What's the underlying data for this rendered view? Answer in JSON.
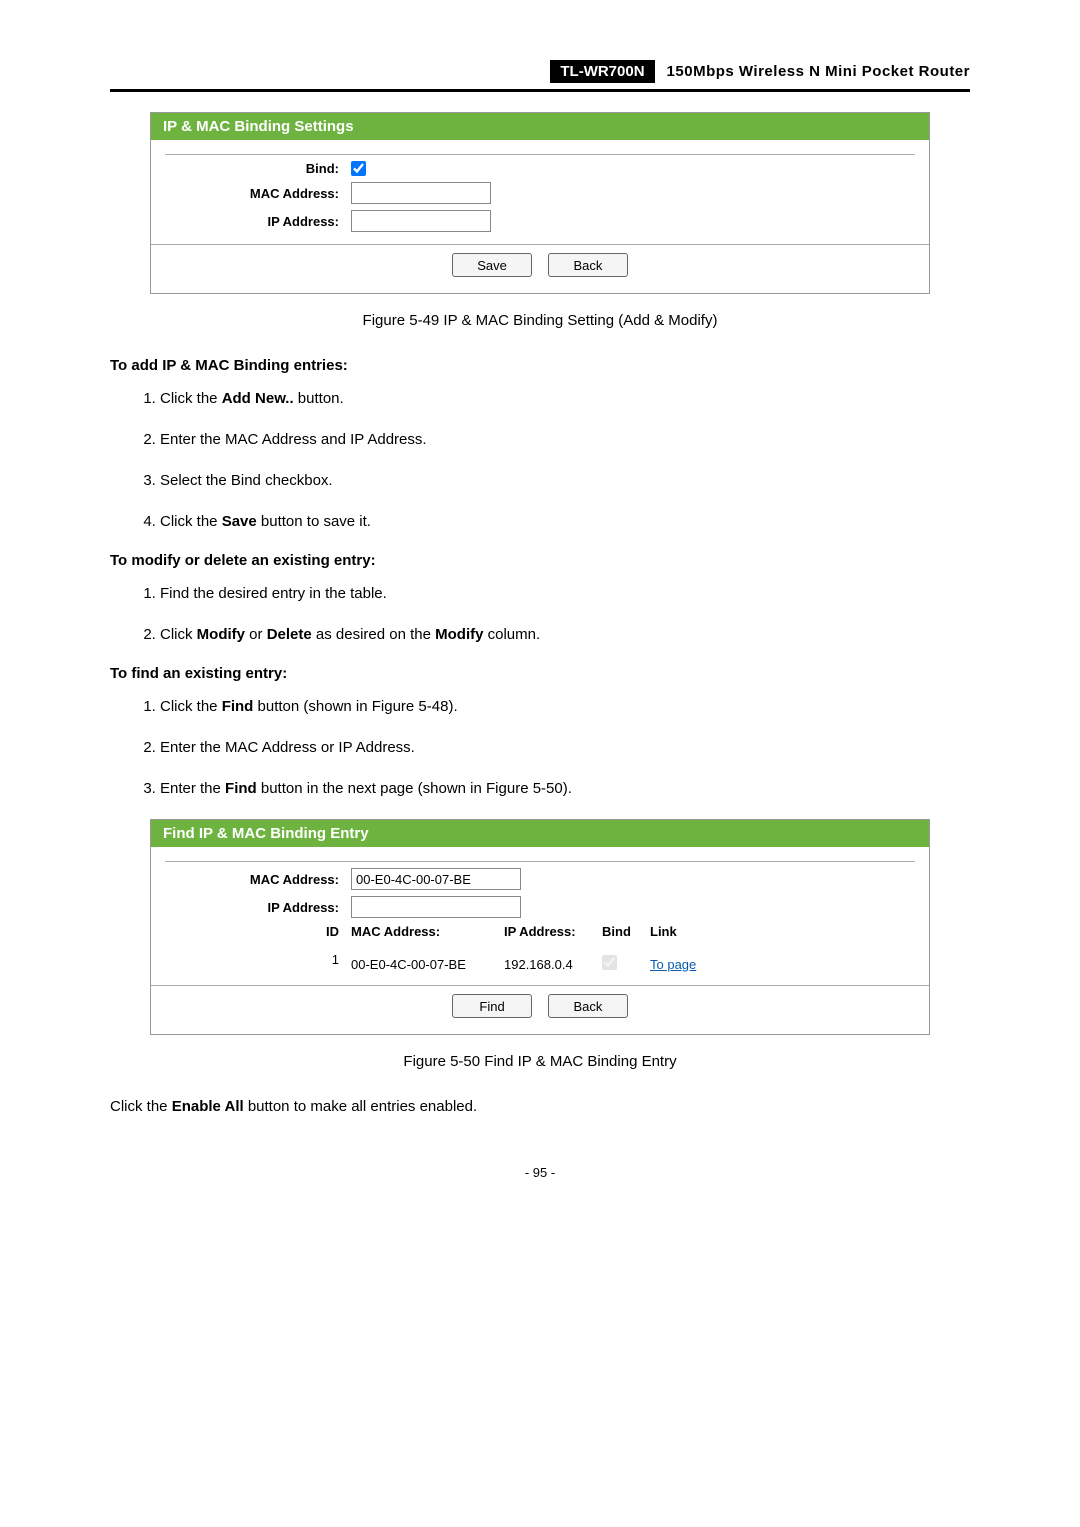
{
  "header": {
    "model": "TL-WR700N",
    "subtitle": "150Mbps Wireless N Mini Pocket Router"
  },
  "panel1": {
    "title": "IP & MAC Binding Settings",
    "labels": {
      "bind": "Bind:",
      "mac": "MAC Address:",
      "ip": "IP Address:"
    },
    "inputs": {
      "mac": "",
      "ip": ""
    },
    "buttons": {
      "save": "Save",
      "back": "Back"
    }
  },
  "caption1": "Figure 5-49 IP & MAC Binding Setting (Add & Modify)",
  "section_add": {
    "heading": "To add IP & MAC Binding entries:",
    "steps": [
      {
        "pre": "Click the ",
        "b": "Add New..",
        "post": " button."
      },
      {
        "pre": "Enter the MAC Address and IP Address."
      },
      {
        "pre": "Select the Bind checkbox."
      },
      {
        "pre": "Click the ",
        "b": "Save",
        "post": " button to save it."
      }
    ]
  },
  "section_modify": {
    "heading": "To modify or delete an existing entry:",
    "steps": [
      {
        "pre": "Find the desired entry in the table."
      },
      {
        "pre": "Click ",
        "b": "Modify",
        "mid1": " or ",
        "b2": "Delete",
        "mid2": " as desired on the ",
        "b3": "Modify",
        "post": " column."
      }
    ]
  },
  "section_find": {
    "heading": "To find an existing entry:",
    "steps": [
      {
        "pre": "Click the ",
        "b": "Find",
        "post": " button (shown in Figure 5-48)."
      },
      {
        "pre": "Enter the MAC Address or IP Address."
      },
      {
        "pre": "Enter the ",
        "b": "Find",
        "post": " button in the next page (shown in Figure 5-50)."
      }
    ]
  },
  "panel2": {
    "title": "Find IP & MAC Binding Entry",
    "labels": {
      "mac": "MAC Address:",
      "ip": "IP Address:",
      "id": "ID"
    },
    "inputs": {
      "mac": "00-E0-4C-00-07-BE",
      "ip": ""
    },
    "thead": {
      "mac": "MAC Address:",
      "ip": "IP Address:",
      "bind": "Bind",
      "link": "Link"
    },
    "row": {
      "id": "1",
      "mac": "00-E0-4C-00-07-BE",
      "ip": "192.168.0.4",
      "link": "To page"
    },
    "buttons": {
      "find": "Find",
      "back": "Back"
    }
  },
  "caption2": "Figure 5-50 Find IP & MAC Binding Entry",
  "final": {
    "pre": "Click the ",
    "b": "Enable All",
    "post": " button to make all entries enabled."
  },
  "pagenum": "- 95 -"
}
